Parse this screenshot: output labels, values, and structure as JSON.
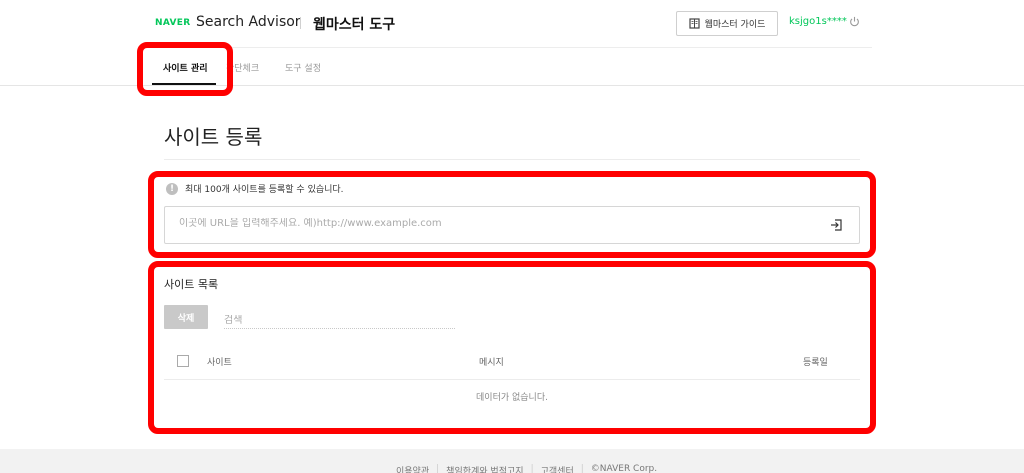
{
  "header": {
    "brand": "NAVER",
    "product": "Search Advisor",
    "section_title": "웹마스터 도구",
    "guide_button": "웹마스터 가이드",
    "user_id": "ksjgo1s****"
  },
  "tabs": [
    {
      "label": "사이트 관리",
      "active": true
    },
    {
      "label": "간단체크",
      "active": false
    },
    {
      "label": "도구 설정",
      "active": false
    }
  ],
  "page": {
    "title": "사이트 등록",
    "info_text": "최대 100개 사이트를 등록할 수 있습니다.",
    "url_placeholder": "이곳에 URL을 입력해주세요. 예)http://www.example.com"
  },
  "site_list": {
    "title": "사이트 목록",
    "delete_button": "삭제",
    "search_placeholder": "검색",
    "columns": [
      "사이트",
      "메시지",
      "등록일"
    ],
    "empty_message": "데이터가 없습니다."
  },
  "footer": {
    "links": [
      "이용약관",
      "책임한계와 법적고지",
      "고객센터",
      "©NAVER Corp."
    ]
  },
  "colors": {
    "brand_green": "#03c75a",
    "highlight_red": "#ff0000"
  }
}
